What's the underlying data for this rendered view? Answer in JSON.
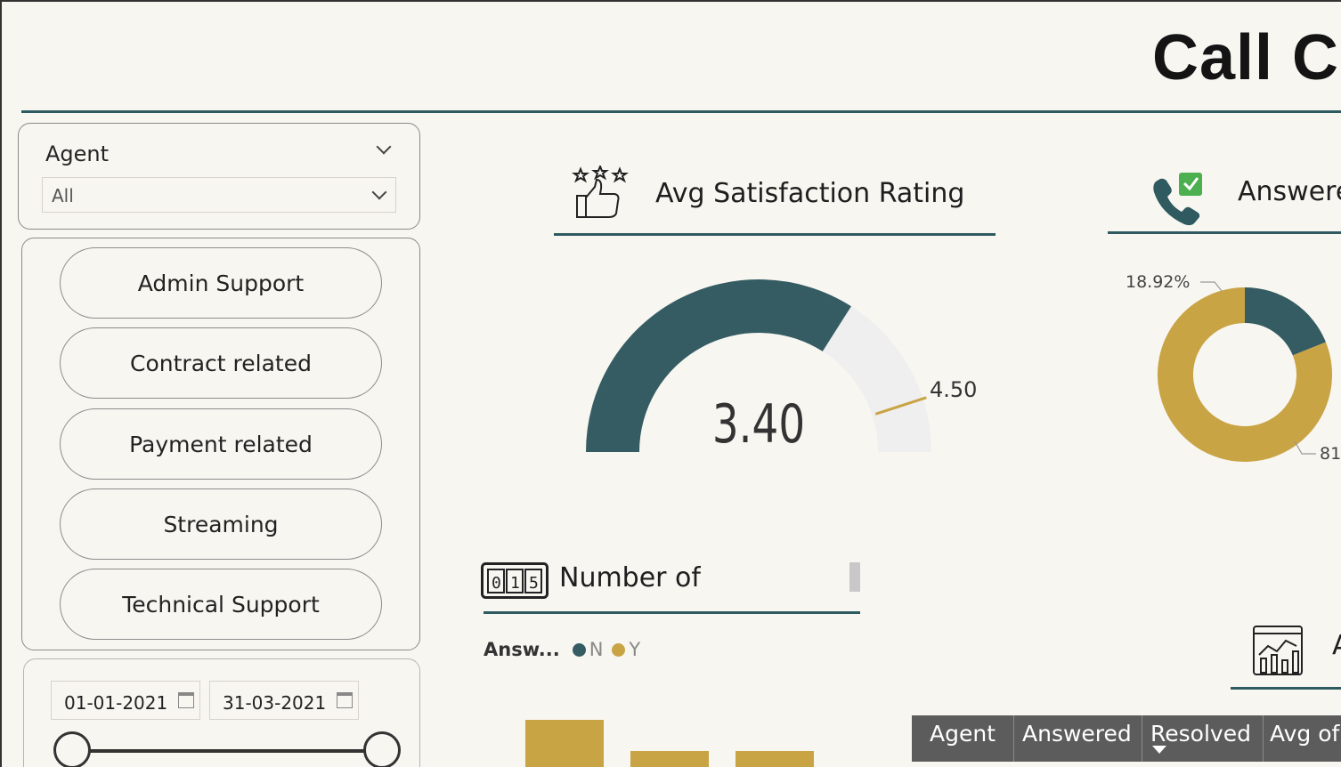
{
  "header": {
    "title": "Call C"
  },
  "slicer": {
    "title": "Agent",
    "selected": "All"
  },
  "topic_buttons": [
    {
      "label": "Admin Support"
    },
    {
      "label": "Contract related"
    },
    {
      "label": "Payment related"
    },
    {
      "label": "Streaming"
    },
    {
      "label": "Technical Support"
    }
  ],
  "date_range": {
    "start": "01-01-2021",
    "end": "31-03-2021",
    "range": [
      0.0,
      1.0
    ]
  },
  "kpi_satisfaction": {
    "label": "Avg Satisfaction Rating",
    "icon": "rating-thumbs-up-icon"
  },
  "kpi_answered": {
    "label": "Answere",
    "icon": "phone-check-icon"
  },
  "kpi_number": {
    "label": "Number of",
    "icon": "counter-icon"
  },
  "kpi_partial": {
    "label": "A",
    "icon": "analytics-chart-icon"
  },
  "colors": {
    "primary": "#355c63",
    "accent": "#c9a445",
    "track": "#efefef",
    "header_rule": "#2f5a60"
  },
  "chart_data": [
    {
      "type": "gauge",
      "value_label": "3.40",
      "value": 3.4,
      "target_label": "4.50",
      "target": 4.5,
      "min": 0,
      "max": 5
    },
    {
      "type": "pie",
      "donut": true,
      "values": [
        18.92,
        81.08
      ],
      "value_labels": [
        "18.92%",
        "81"
      ],
      "colors": [
        "#355c63",
        "#c9a445"
      ]
    },
    {
      "type": "bar",
      "legend_title": "Answ...",
      "legend": [
        {
          "name": "N",
          "color": "#355c63"
        },
        {
          "name": "Y",
          "color": "#c9a445"
        }
      ],
      "series": [
        {
          "name": "Y",
          "values": [
            56,
            29,
            29
          ]
        }
      ]
    }
  ],
  "table": {
    "columns": [
      "Agent",
      "Answered",
      "Resolved",
      "Avg of"
    ]
  }
}
